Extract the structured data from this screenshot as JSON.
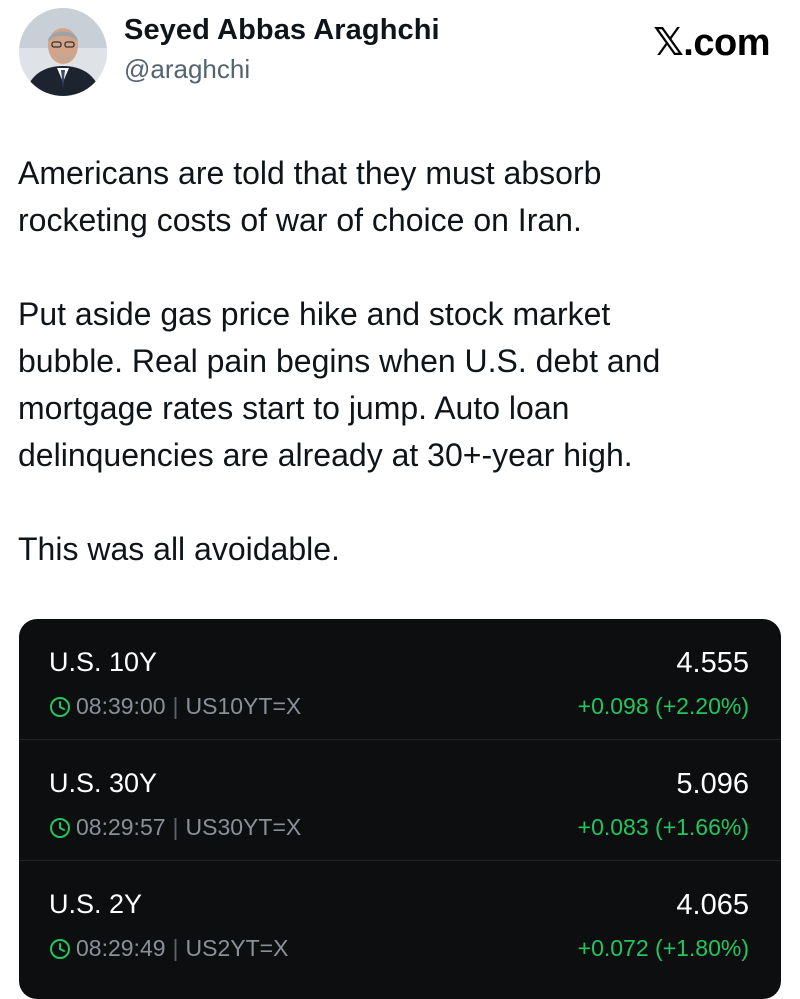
{
  "author": {
    "name": "Seyed Abbas Araghchi",
    "handle": "@araghchi"
  },
  "brand": "𝕏.com",
  "tweet": {
    "paragraphs": [
      "Americans are told that they must absorb\nrocketing costs of war of choice on Iran.",
      "Put aside gas price hike and stock market\nbubble. Real pain begins when U.S. debt and\nmortgage rates start to jump. Auto loan\ndelinquencies are already at 30+-year high.",
      "This was all avoidable."
    ]
  },
  "colors": {
    "card_background": "#0d0e10",
    "positive_change": "#22c55e",
    "meta_text": "#8a8f98"
  },
  "quotes": [
    {
      "name": "U.S. 10Y",
      "price": "4.555",
      "time": "08:39:00",
      "ticker": "US10YT=X",
      "change": "+0.098 (+2.20%)"
    },
    {
      "name": "U.S. 30Y",
      "price": "5.096",
      "time": "08:29:57",
      "ticker": "US30YT=X",
      "change": "+0.083 (+1.66%)"
    },
    {
      "name": "U.S. 2Y",
      "price": "4.065",
      "time": "08:29:49",
      "ticker": "US2YT=X",
      "change": "+0.072 (+1.80%)"
    }
  ]
}
